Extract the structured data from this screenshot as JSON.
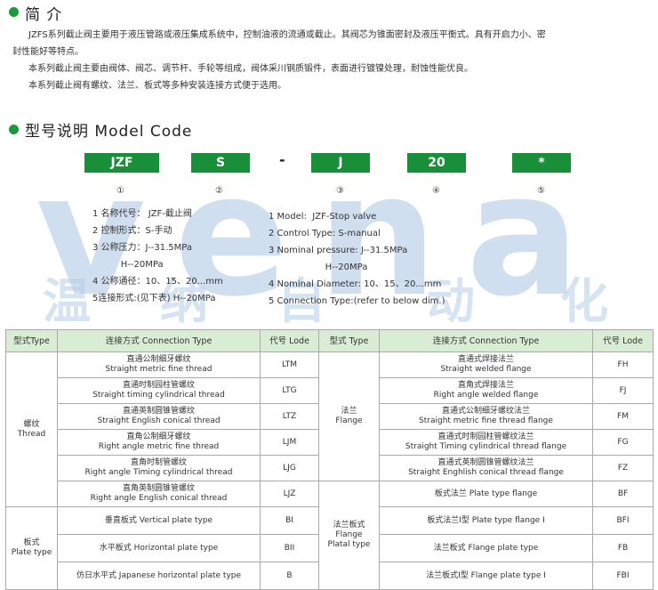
{
  "intro": {
    "title": "简 介",
    "lines": [
      "JZFS系列截止阀主要用于液压管路或液压集成系统中，控制油液的流通或截止。其阀芯为锥面密封及液压平衡式。具有开启力小、密",
      "封性能好等特点。",
      "本系列截止阀主要由阀体、阀芯、调节杆、手轮等组成，阀体采川钢质锻件，表面进行镀镍处理，耐蚀性能优良。",
      "本系列截止阀有螺纹、法兰、板式等多种安装连接方式便于选用。"
    ]
  },
  "model": {
    "title": "型号说明 Model Code",
    "boxes": [
      "JZF",
      "S",
      "J",
      "20",
      "*"
    ],
    "separator": "-",
    "numbers": [
      "①",
      "②",
      "③",
      "④",
      "⑤"
    ],
    "cn_desc": [
      "1 名称代号： JZF-截止阀",
      "2 控制形式：S-手动",
      "3 公称压力：J--31.5MPa",
      "          H--20MPa",
      "4 公称通径：10、15、20...mm",
      "5连接形式:(见下表) H--20MPa"
    ],
    "en_desc": [
      "1 Model:  JZF-Stop valve",
      "2 Control Type: S-manual",
      "3 Nominal pressure: J--31.5MPa",
      "                    H--20MPa",
      "4 Nominal Diameter: 10、15、20...mm",
      "5 Connection Type:(refer to below dim.)"
    ]
  },
  "watermark": {
    "letters": "vena",
    "cn": [
      "温",
      "纳",
      "自",
      "动",
      "化"
    ]
  },
  "table": {
    "headers": [
      "型式Type",
      "连接方式 Connection Type",
      "代号 Lode",
      "型式 Type",
      "连接方式 Connection Type",
      "代号 Lode"
    ],
    "left_groups": [
      {
        "type_cn": "螺纹",
        "type_en": "Thread"
      },
      {
        "type_cn": "板式",
        "type_en": "Plate type"
      }
    ],
    "left_rows": [
      {
        "cn": "直通公制细牙螺纹",
        "en": "Straight metric fine thread",
        "code": "LTM"
      },
      {
        "cn": "直通时制园柱管螺纹",
        "en": "Straight timing cylindrical thread",
        "code": "LTG"
      },
      {
        "cn": "直通英制圆锥管螺纹",
        "en": "Straight English conical thread",
        "code": "LTZ"
      },
      {
        "cn": "直角公制细牙螺纹",
        "en": "Right angle metric fine thread",
        "code": "LJM"
      },
      {
        "cn": "直角时制管螺纹",
        "en": "Right angle Timing cylindrical thread",
        "code": "LJG"
      },
      {
        "cn": "直角英制圆锥管螺纹",
        "en": "Right angle English conical thread",
        "code": "LJZ"
      },
      {
        "cn": "垂直板式 Vertical plate type",
        "en": "",
        "code": "BI"
      },
      {
        "cn": "水平板式 Horizontal plate type",
        "en": "",
        "code": "BII"
      },
      {
        "cn": "仿日水平式 Japanese horizontal plate type",
        "en": "",
        "code": "B"
      }
    ],
    "right_groups": [
      {
        "type_cn": "法兰",
        "type_en": "Flange"
      },
      {
        "type_cn": "法兰板式",
        "type_en": "Flange",
        "type_en2": "Platal type"
      }
    ],
    "right_rows": [
      {
        "cn": "直通式焊接法兰",
        "en": "Straight welded flange",
        "code": "FH"
      },
      {
        "cn": "直角式焊接法兰",
        "en": "Right angle welded flange",
        "code": "FJ"
      },
      {
        "cn": "直通式公制细牙螺纹法兰",
        "en": "Straight metric fine thread flange",
        "code": "FM"
      },
      {
        "cn": "直通式时制园柱管螺纹法兰",
        "en": "Straight Timing cylindrical thread flange",
        "code": "FG"
      },
      {
        "cn": "直通式英制圆锥管螺纹法兰",
        "en": "Straight Enghlish conical thread flange",
        "code": "FZ"
      },
      {
        "cn": "板式法兰 Plate type flange",
        "en": "",
        "code": "BF"
      },
      {
        "cn": "板式法兰I型 Plate type flange I",
        "en": "",
        "code": "BFI"
      },
      {
        "cn": "法兰板式 Flange plate type",
        "en": "",
        "code": "FB"
      },
      {
        "cn": "法兰板式I型 Flange plate type I",
        "en": "",
        "code": "FBI"
      }
    ]
  }
}
